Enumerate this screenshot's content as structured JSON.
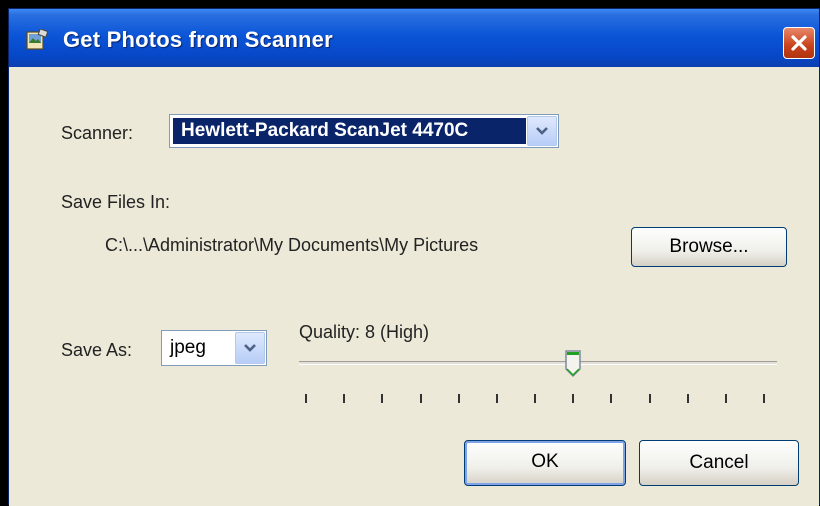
{
  "window": {
    "title": "Get Photos from Scanner",
    "icon": "scanner-photo-icon",
    "close_icon": "close-icon",
    "titlebar_color": "#0b55d8",
    "close_color": "#c8421c"
  },
  "scanner": {
    "label": "Scanner:",
    "selected": "Hewlett-Packard ScanJet 4470C"
  },
  "save_files": {
    "label": "Save Files In:",
    "path": "C:\\...\\Administrator\\My Documents\\My Pictures",
    "browse_label": "Browse..."
  },
  "save_as": {
    "label": "Save As:",
    "selected": "jpeg"
  },
  "quality": {
    "label": "Quality: 8 (High)",
    "value": 8,
    "min": 1,
    "max": 13
  },
  "buttons": {
    "ok_label": "OK",
    "cancel_label": "Cancel"
  }
}
